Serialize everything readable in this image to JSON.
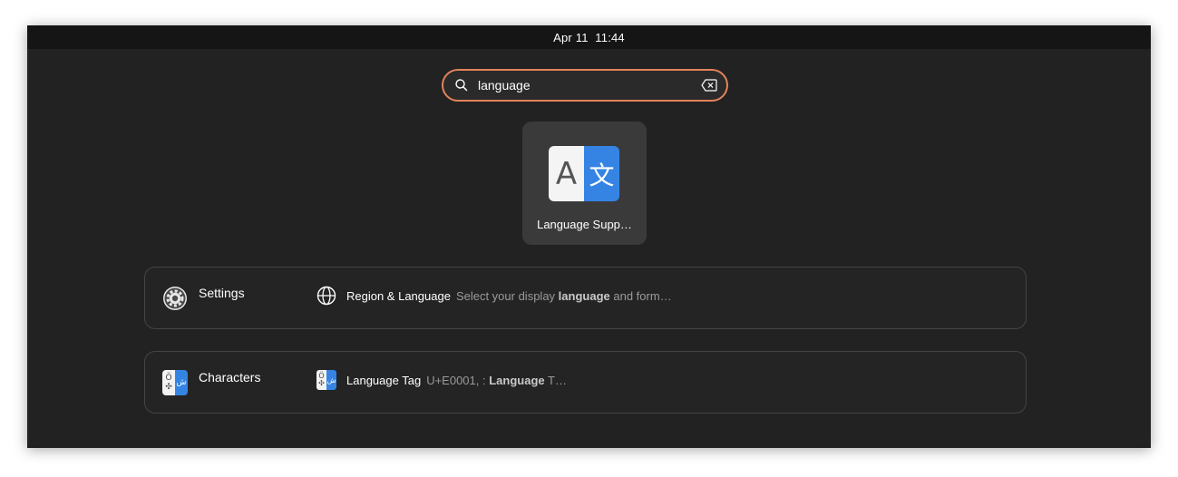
{
  "topbar": {
    "date": "Apr 11",
    "time": "11:44"
  },
  "search": {
    "value": "language",
    "icon": "search-icon",
    "clear_icon": "backspace-clear-icon",
    "focus_color": "#e2835a"
  },
  "app_results": [
    {
      "label": "Language Supp…",
      "icon": "language-support-icon",
      "icon_left_glyph": "A",
      "icon_right_glyph": "文"
    }
  ],
  "providers": [
    {
      "name": "Settings",
      "icon": "settings-gear-icon",
      "result": {
        "title": "Region & Language",
        "icon": "globe-icon",
        "desc_before": "Select your display ",
        "desc_match": "language",
        "desc_after": " and form…"
      }
    },
    {
      "name": "Characters",
      "icon": "characters-app-icon",
      "result": {
        "title": "Language Tag",
        "icon": "characters-app-icon",
        "desc_before": "U+E0001, : ",
        "desc_match": "Language",
        "desc_after": " T…"
      }
    }
  ],
  "colors": {
    "accent": "#3584e4",
    "background": "#222222",
    "topbar": "#151515"
  }
}
